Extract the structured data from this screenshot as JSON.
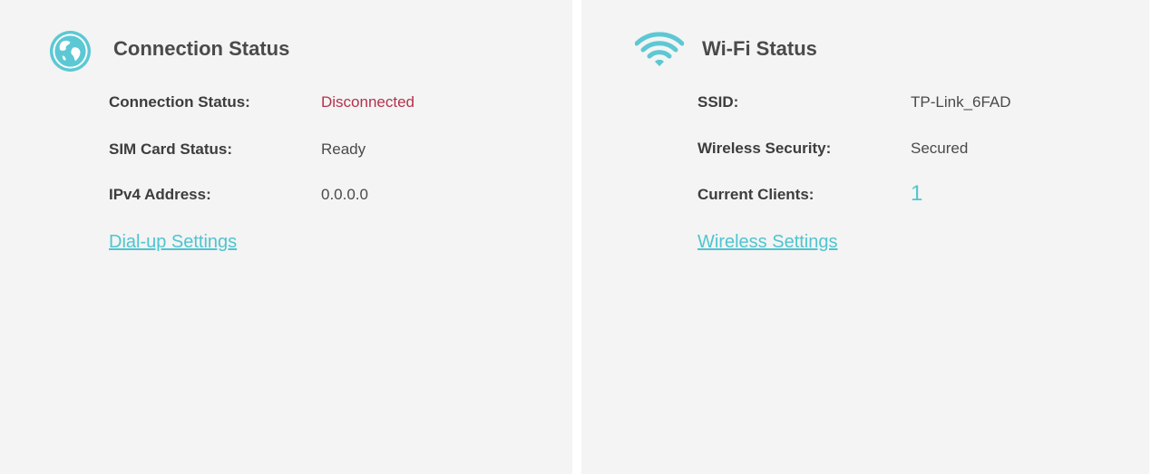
{
  "connection": {
    "title": "Connection Status",
    "icon": "globe-icon",
    "rows": [
      {
        "label": "Connection Status:",
        "value": "Disconnected"
      },
      {
        "label": "SIM Card Status:",
        "value": "Ready"
      },
      {
        "label": "IPv4 Address:",
        "value": "0.0.0.0"
      }
    ],
    "link": "Dial-up Settings"
  },
  "wifi": {
    "title": "Wi-Fi Status",
    "icon": "wifi-icon",
    "rows": [
      {
        "label": "SSID:",
        "value": "TP-Link_6FAD"
      },
      {
        "label": "Wireless Security:",
        "value": "Secured"
      },
      {
        "label": "Current Clients:",
        "value": "1"
      }
    ],
    "link": "Wireless Settings"
  },
  "colors": {
    "accent": "#4fc4d0",
    "error": "#b5314d",
    "panel_bg": "#f3f4f3",
    "text": "#4a4a4a"
  }
}
